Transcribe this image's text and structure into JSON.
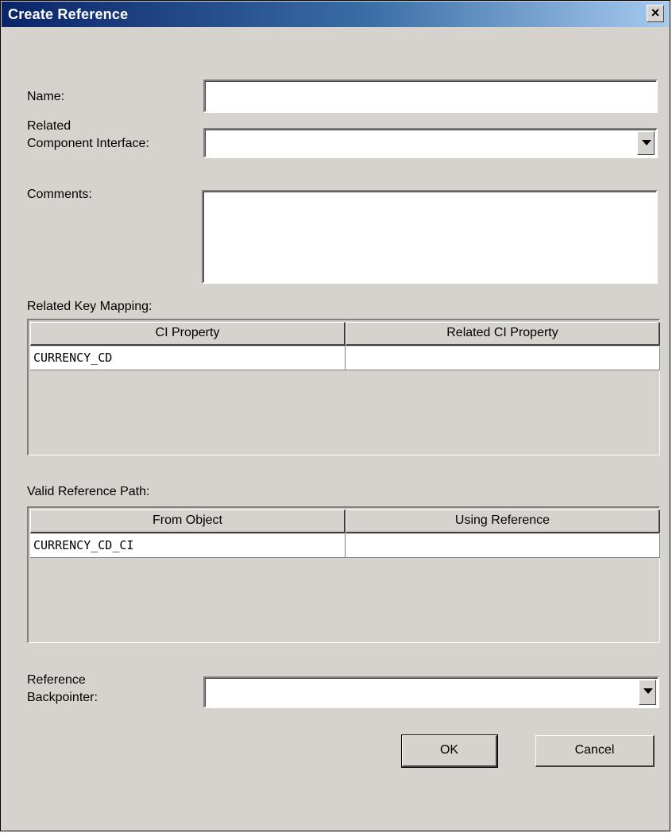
{
  "window": {
    "title": "Create Reference",
    "close_glyph": "×",
    "close_icon": "close-icon"
  },
  "form": {
    "name_label": "Name:",
    "name_value": "",
    "related_ci_label_line1": "Related",
    "related_ci_label_line2": "Component Interface:",
    "related_ci_value": "",
    "comments_label": "Comments:",
    "comments_value": "",
    "key_mapping_label": "Related Key Mapping:",
    "key_mapping": {
      "columns": [
        "CI Property",
        "Related CI Property"
      ],
      "rows": [
        [
          "CURRENCY_CD",
          ""
        ]
      ]
    },
    "ref_path_label": "Valid Reference Path:",
    "ref_path": {
      "columns": [
        "From Object",
        "Using Reference"
      ],
      "rows": [
        [
          "CURRENCY_CD_CI",
          ""
        ]
      ]
    },
    "backpointer_label_line1": "Reference",
    "backpointer_label_line2": "Backpointer:",
    "backpointer_value": ""
  },
  "buttons": {
    "ok": "OK",
    "cancel": "Cancel"
  },
  "colors": {
    "dialog_bg": "#d6d3ce",
    "title_start": "#0a246a",
    "title_end": "#a6caf0"
  }
}
